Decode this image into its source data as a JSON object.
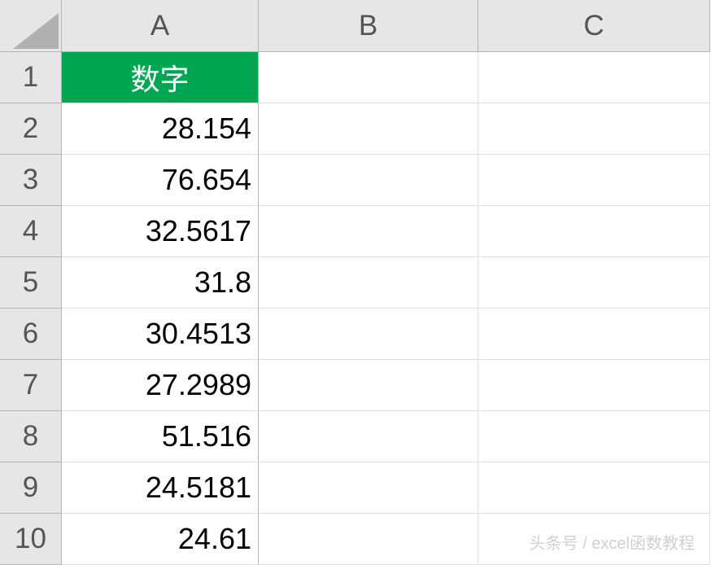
{
  "columns": [
    "A",
    "B",
    "C"
  ],
  "rows": [
    "1",
    "2",
    "3",
    "4",
    "5",
    "6",
    "7",
    "8",
    "9",
    "10"
  ],
  "header": {
    "A1": "数字"
  },
  "data": {
    "A2": "28.154",
    "A3": "76.654",
    "A4": "32.5617",
    "A5": "31.8",
    "A6": "30.4513",
    "A7": "27.2989",
    "A8": "51.516",
    "A9": "24.5181",
    "A10": "24.61"
  },
  "watermark": "头条号 / excel函数教程"
}
